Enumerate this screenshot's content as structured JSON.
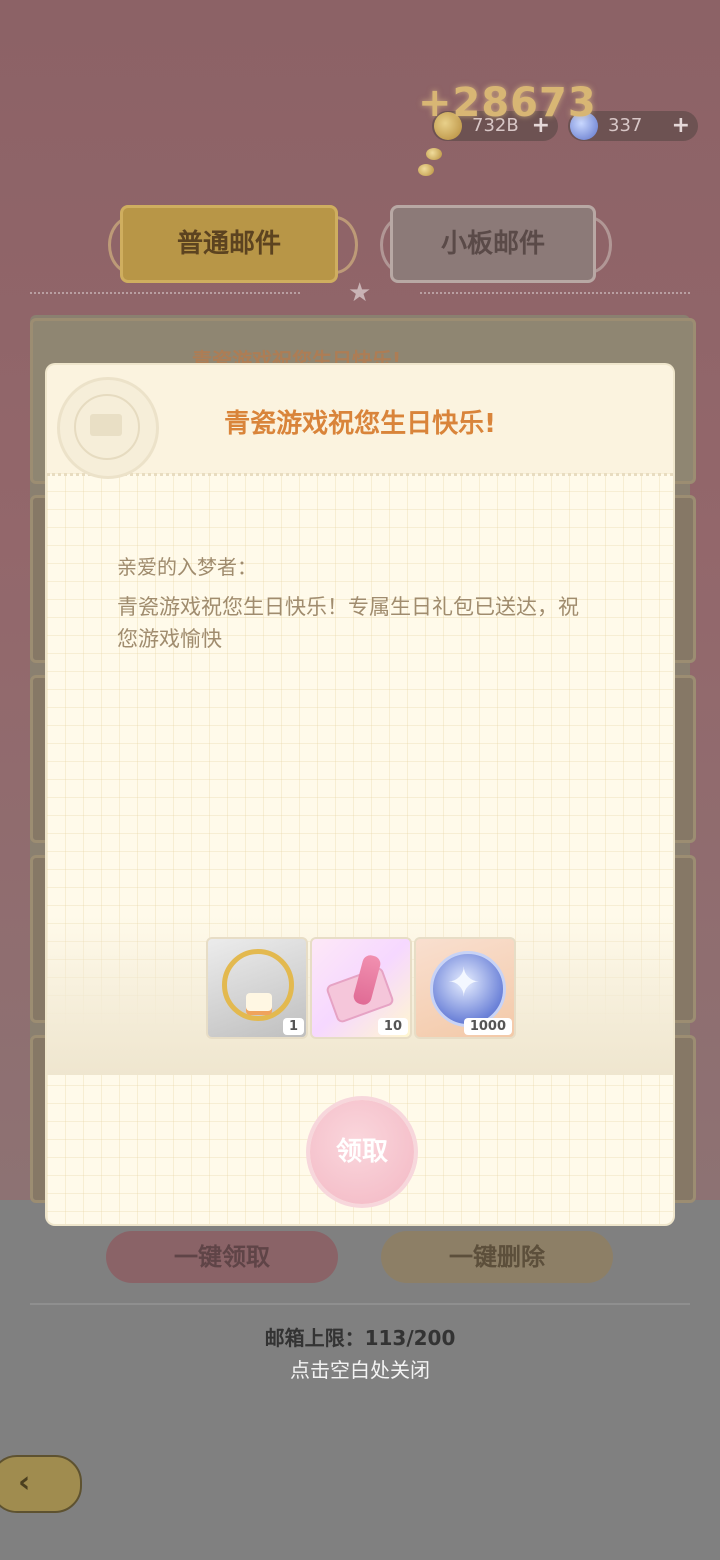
{
  "currency": {
    "coins": "732B",
    "gems": "337",
    "gain": "+28673",
    "plus": "+"
  },
  "tabs": [
    {
      "label": "普通邮件"
    },
    {
      "label": "小板邮件"
    }
  ],
  "background_mail": {
    "title": "青瓷游戏祝您生日快乐!"
  },
  "modal": {
    "title": "青瓷游戏祝您生日快乐!",
    "greeting": "亲爱的入梦者：",
    "body": "青瓷游戏祝您生日快乐！专属生日礼包已送达，祝您游戏愉快",
    "rewards": [
      {
        "icon": "birthday-frame-icon",
        "quantity": "1"
      },
      {
        "icon": "ticket-icon",
        "quantity": "10"
      },
      {
        "icon": "compass-gem-icon",
        "quantity": "1000"
      }
    ],
    "claim_label": "领取"
  },
  "footer": {
    "claim_all": "一键领取",
    "delete_all": "一键删除",
    "capacity": "邮箱上限：113/200",
    "close_hint": "点击空白处关闭"
  },
  "colors": {
    "title_orange": "#d9843a",
    "body_text": "#a08c6e",
    "claim_pink": "#f3b8c4"
  }
}
